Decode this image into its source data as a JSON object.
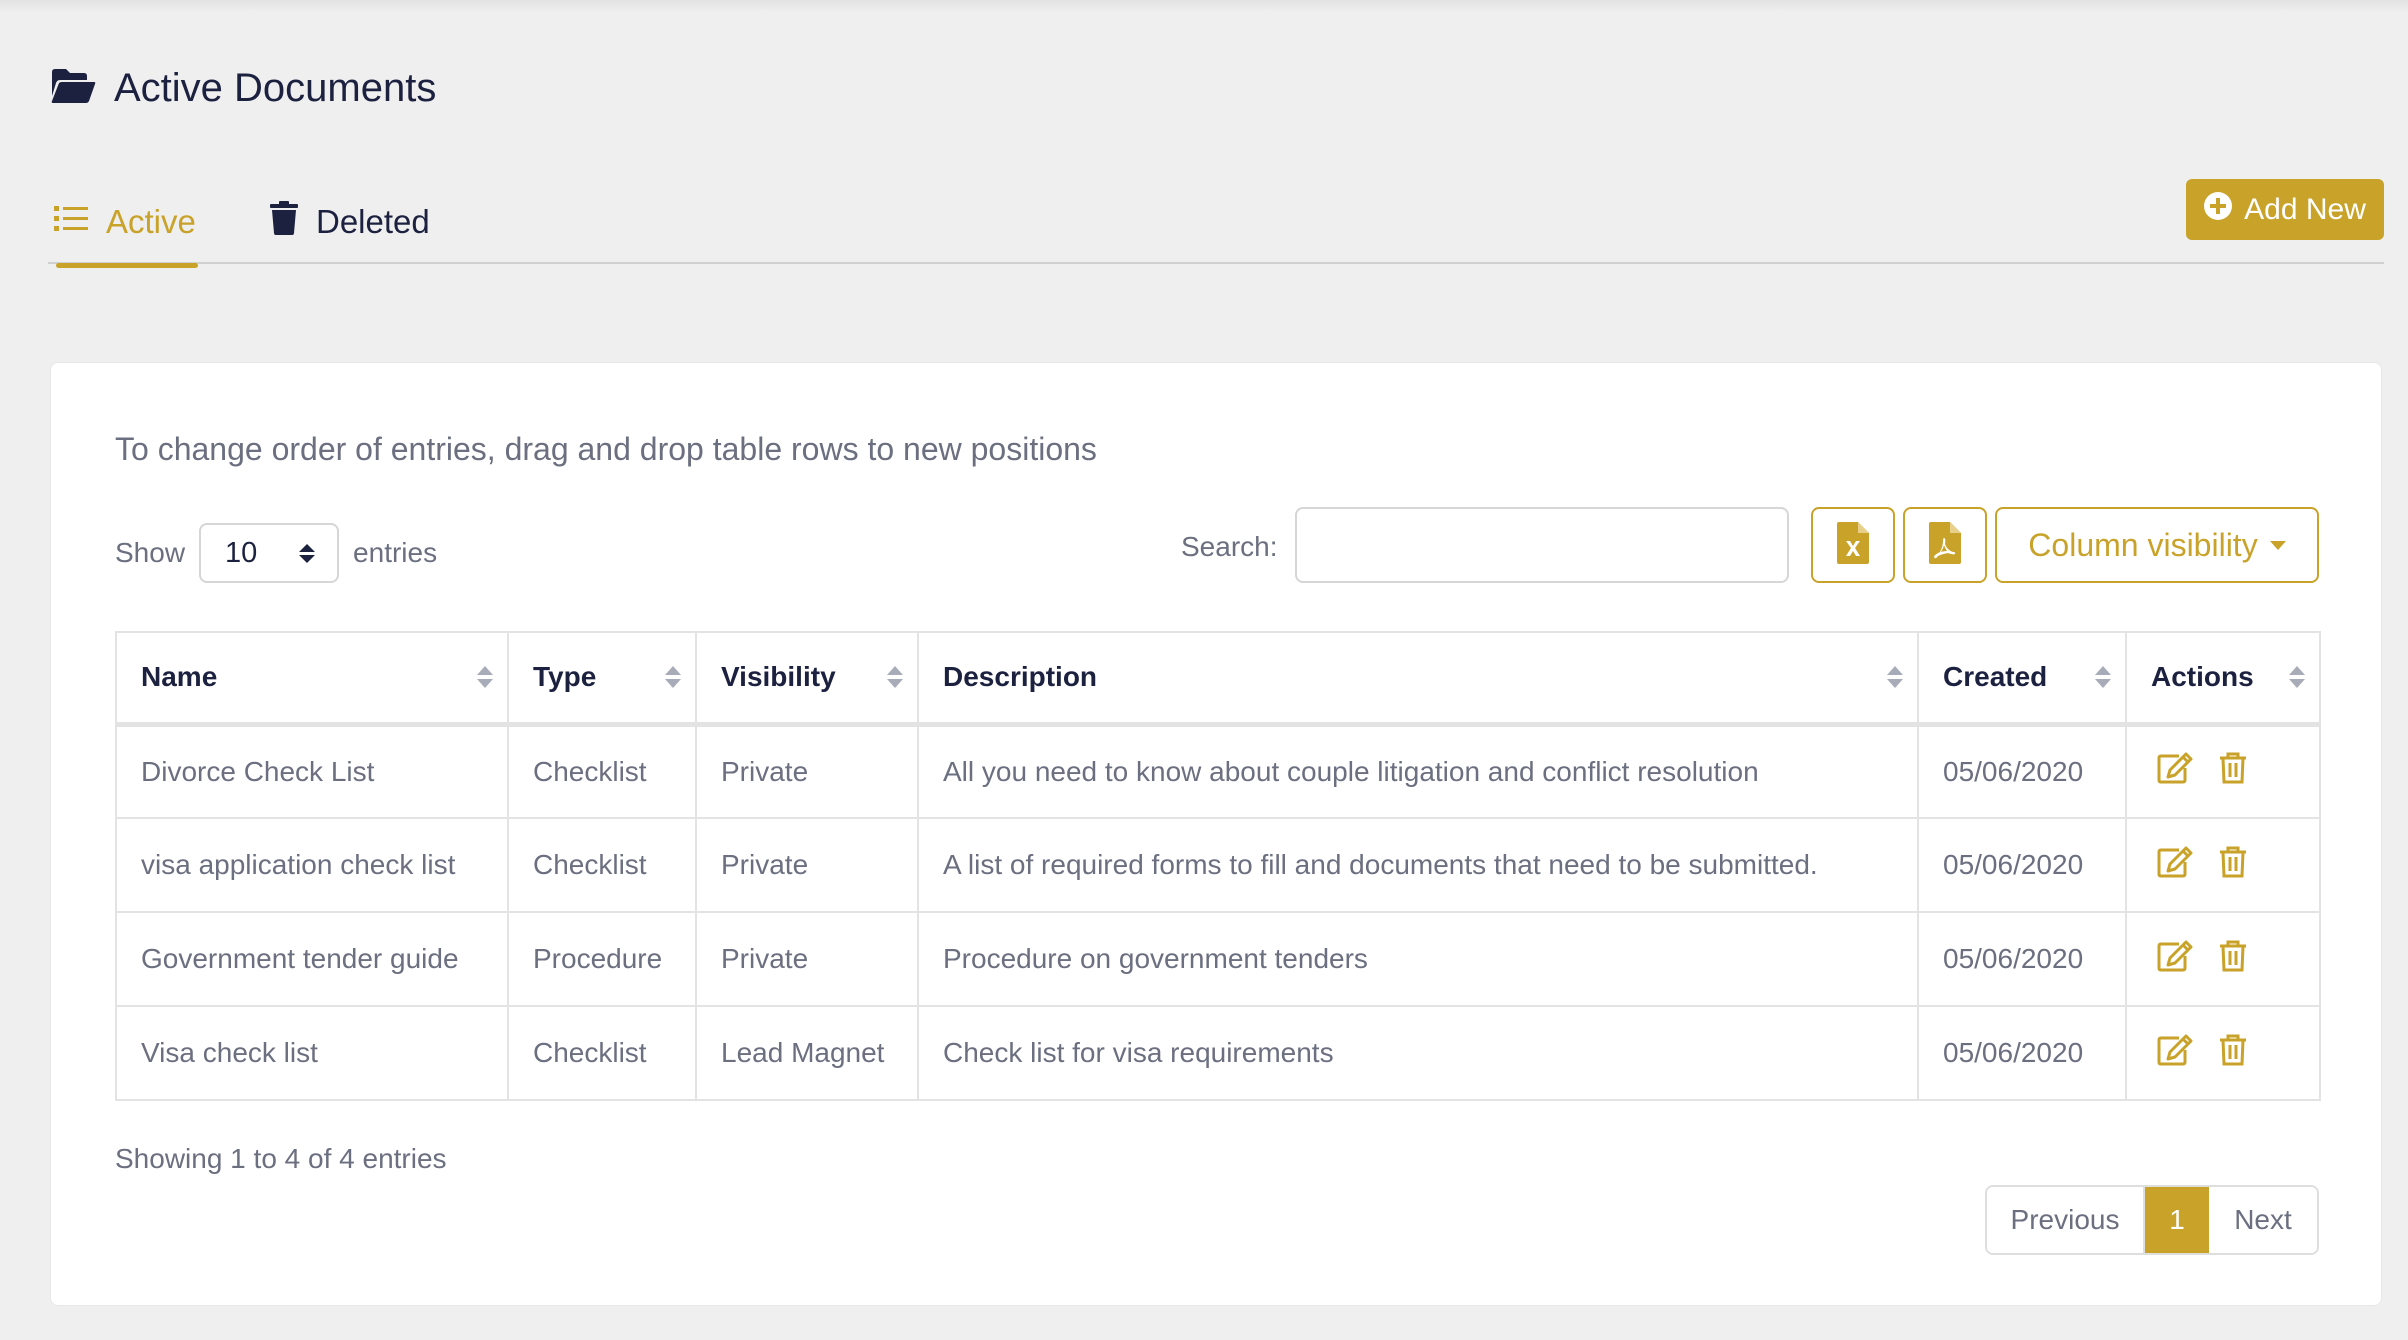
{
  "header": {
    "title": "Active Documents",
    "icon": "folder-open-icon"
  },
  "tabs": [
    {
      "label": "Active",
      "icon": "list-icon",
      "active": true
    },
    {
      "label": "Deleted",
      "icon": "trash-icon",
      "active": false
    }
  ],
  "add_new": {
    "label": "Add New",
    "icon": "plus-circle-icon"
  },
  "hint": "To change order of entries, drag and drop table rows to new positions",
  "length": {
    "show": "Show",
    "value": "10",
    "entries": "entries"
  },
  "search": {
    "label": "Search:",
    "value": ""
  },
  "buttons": {
    "excel_icon": "file-excel-icon",
    "pdf_icon": "file-pdf-icon",
    "column_visibility": "Column visibility"
  },
  "table": {
    "columns": [
      "Name",
      "Type",
      "Visibility",
      "Description",
      "Created",
      "Actions"
    ],
    "rows": [
      {
        "name": "Divorce Check List",
        "type": "Checklist",
        "visibility": "Private",
        "description": "All you need to know about couple litigation and conflict resolution",
        "created": "05/06/2020"
      },
      {
        "name": "visa application check list",
        "type": "Checklist",
        "visibility": "Private",
        "description": "A list of required forms to fill and documents that need to be submitted.",
        "created": "05/06/2020"
      },
      {
        "name": "Government tender guide",
        "type": "Procedure",
        "visibility": "Private",
        "description": "Procedure on government tenders",
        "created": "05/06/2020"
      },
      {
        "name": "Visa check list",
        "type": "Checklist",
        "visibility": "Lead Magnet",
        "description": "Check list for visa requirements",
        "created": "05/06/2020"
      }
    ]
  },
  "info": "Showing 1 to 4 of 4 entries",
  "pagination": {
    "previous": "Previous",
    "current": "1",
    "next": "Next"
  },
  "colors": {
    "accent": "#c9a22a",
    "text_dark": "#1c2140",
    "text_muted": "#6b6f80",
    "background": "#efefef"
  }
}
